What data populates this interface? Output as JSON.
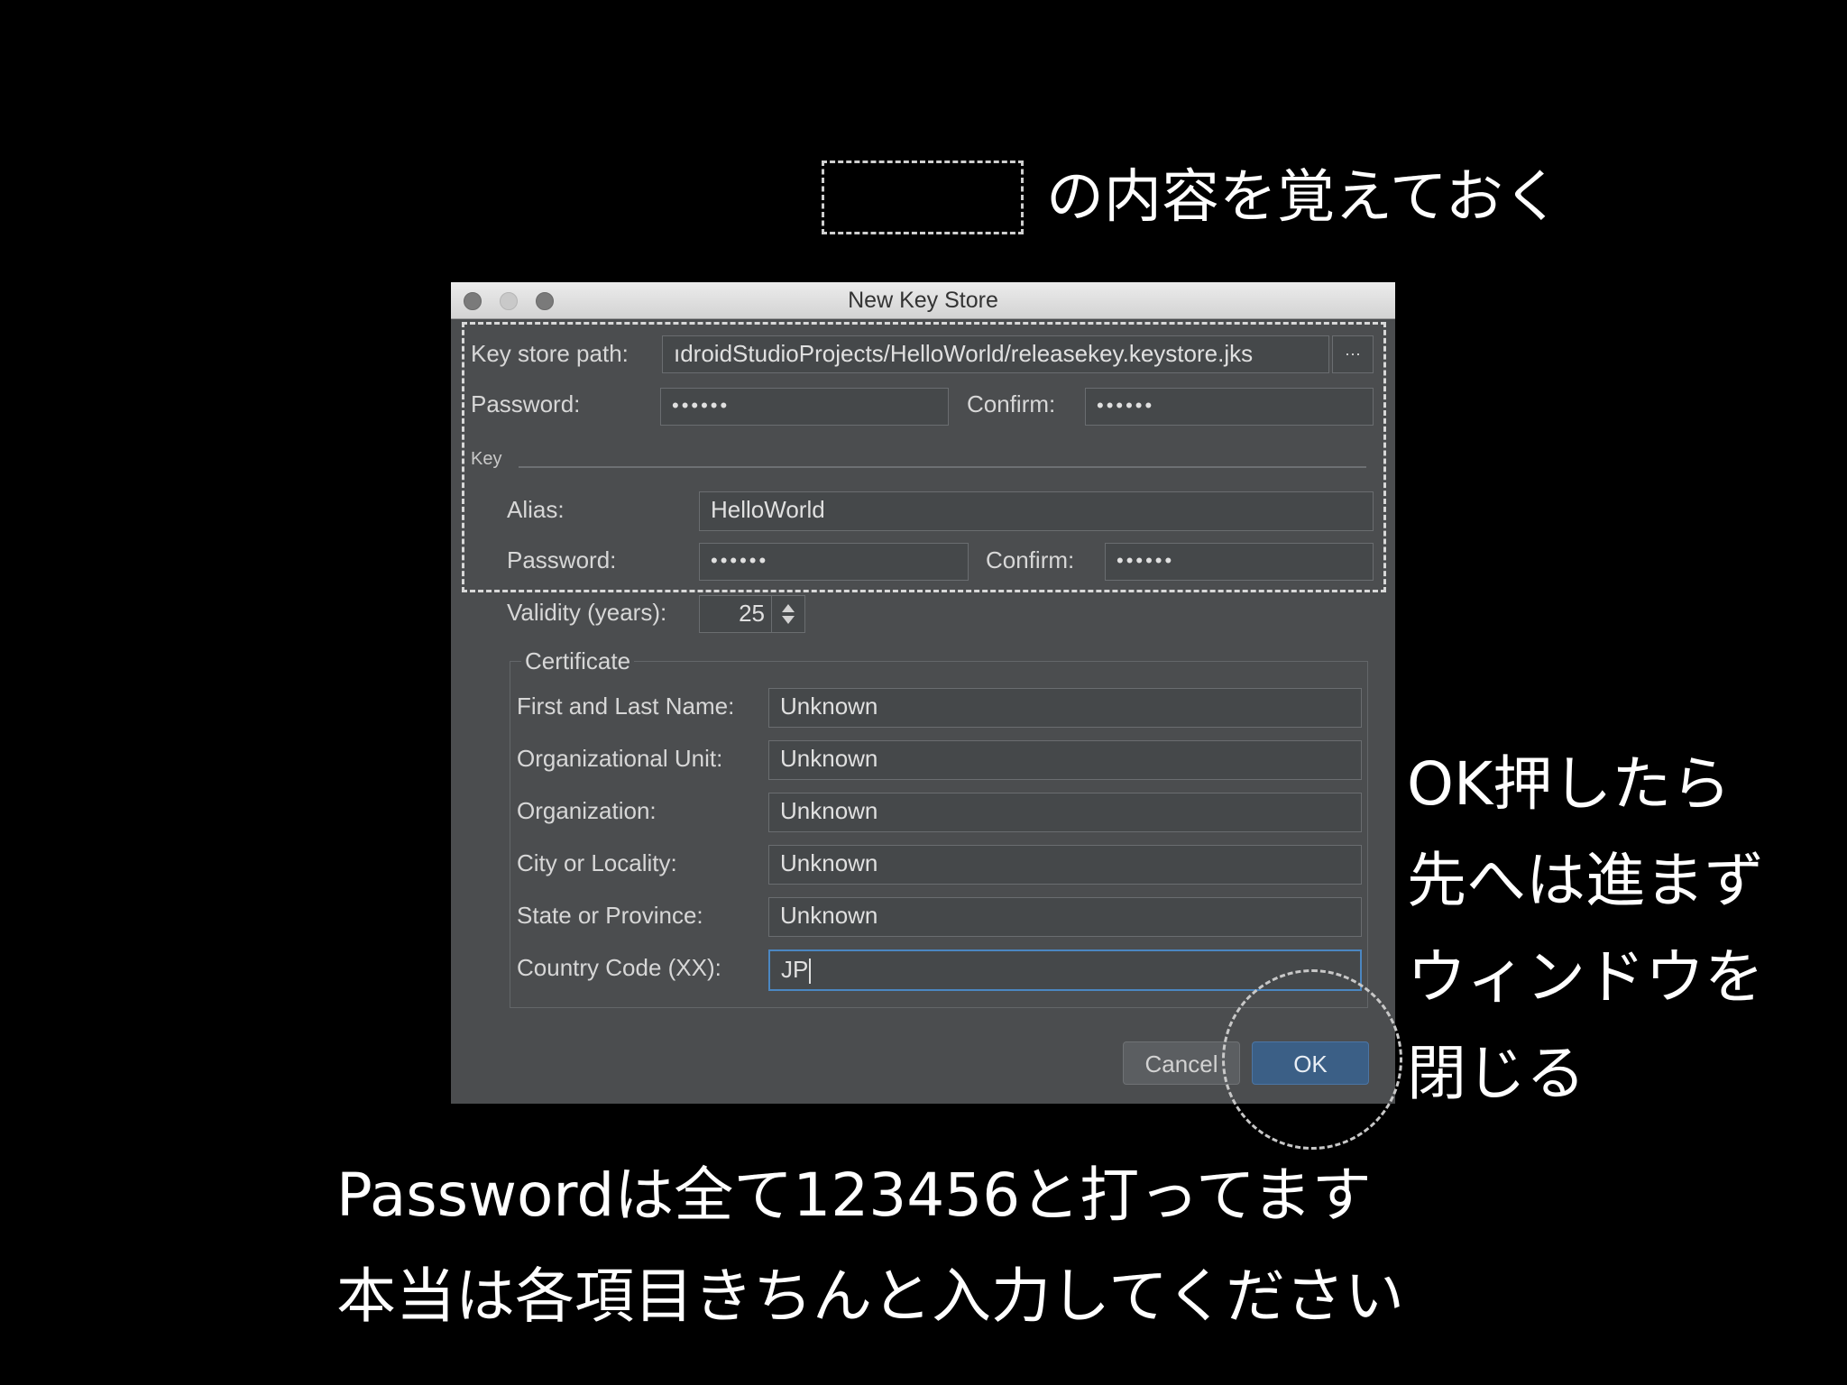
{
  "annotations": {
    "top_caption": "の内容を覚えておく",
    "right_caption": [
      "OK押したら",
      "先へは進まず",
      "ウィンドウを",
      "閉じる"
    ],
    "bottom_caption": [
      "Passwordは全て123456と打ってます",
      "本当は各項目きちんと入力してください"
    ]
  },
  "dialog": {
    "title": "New Key Store",
    "key_store_path_label": "Key store path:",
    "key_store_path_value": "ıdroidStudioProjects/HelloWorld/releasekey.keystore.jks",
    "browse_label": "···",
    "password_label": "Password:",
    "password_value": "••••••",
    "confirm_label": "Confirm:",
    "confirm_value": "••••••",
    "key_group_label": "Key",
    "alias_label": "Alias:",
    "alias_value": "HelloWorld",
    "key_password_label": "Password:",
    "key_password_value": "••••••",
    "key_confirm_label": "Confirm:",
    "key_confirm_value": "••••••",
    "validity_label": "Validity (years):",
    "validity_value": "25",
    "certificate_label": "Certificate",
    "certificate_fields": [
      {
        "label": "First and Last Name:",
        "value": "Unknown"
      },
      {
        "label": "Organizational Unit:",
        "value": "Unknown"
      },
      {
        "label": "Organization:",
        "value": "Unknown"
      },
      {
        "label": "City or Locality:",
        "value": "Unknown"
      },
      {
        "label": "State or Province:",
        "value": "Unknown"
      },
      {
        "label": "Country Code (XX):",
        "value": "JP"
      }
    ],
    "cancel_label": "Cancel",
    "ok_label": "OK"
  },
  "colors": {
    "background": "#000000",
    "dialog_bg": "#4b4d4f",
    "ok_button": "#3b5f86",
    "focus_border": "#4b87c2"
  }
}
